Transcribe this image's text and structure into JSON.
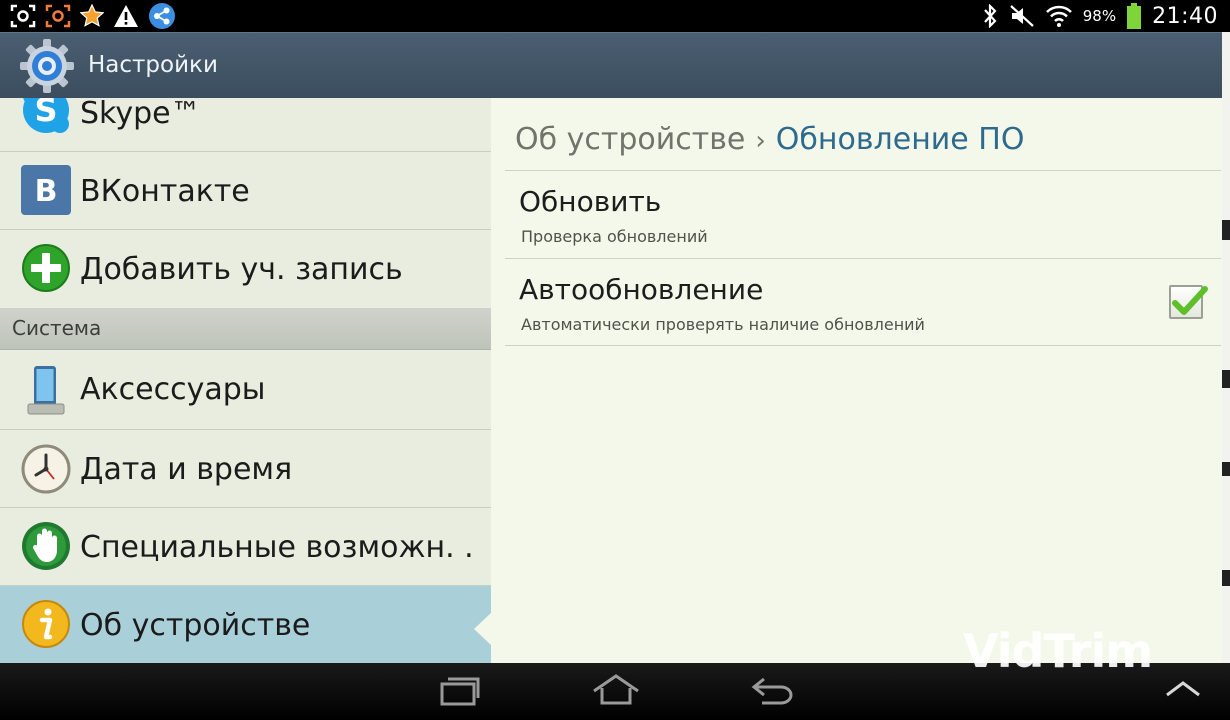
{
  "status_bar": {
    "battery_percent": "98%",
    "battery_level": 0.98,
    "clock": "21:40",
    "left_icons": [
      "screenshot-icon",
      "screenshot-alt-icon",
      "star-icon",
      "warning-icon",
      "share-icon"
    ],
    "right_icons": [
      "bluetooth-icon",
      "mute-icon",
      "wifi-icon",
      "battery-icon"
    ]
  },
  "action_bar": {
    "title": "Настройки",
    "icon": "settings-gear-icon"
  },
  "sidebar": {
    "items": [
      {
        "label": "Skype™",
        "icon": "skype-icon"
      },
      {
        "label": "ВКонтакте",
        "icon": "vk-icon"
      },
      {
        "label": "Добавить уч. запись",
        "icon": "add-account-icon"
      }
    ],
    "section_header": "Система",
    "system_items": [
      {
        "label": "Аксессуары",
        "icon": "accessories-icon"
      },
      {
        "label": "Дата и время",
        "icon": "clock-icon"
      },
      {
        "label": "Специальные возможн. .",
        "icon": "accessibility-hand-icon"
      },
      {
        "label": "Об устройстве",
        "icon": "info-icon",
        "selected": true
      }
    ]
  },
  "detail": {
    "breadcrumb": {
      "parent": "Об устройстве",
      "separator": "›",
      "current": "Обновление ПО"
    },
    "preferences": [
      {
        "title": "Обновить",
        "summary": "Проверка обновлений"
      },
      {
        "title": "Автообновление",
        "summary": "Автоматически проверять наличие обновлений",
        "checked": true
      }
    ]
  },
  "nav_bar": {
    "buttons": [
      "recent-apps-icon",
      "home-icon",
      "back-icon",
      "menu-up-icon"
    ]
  },
  "watermark": "VidTrim",
  "colors": {
    "action_bar": "#3f5264",
    "left_pane": "#e8ede0",
    "right_pane": "#f4f8ea",
    "selected_item": "#a9cfd9",
    "breadcrumb_current": "#2d6a8e",
    "checkmark": "#5fbf2a"
  }
}
